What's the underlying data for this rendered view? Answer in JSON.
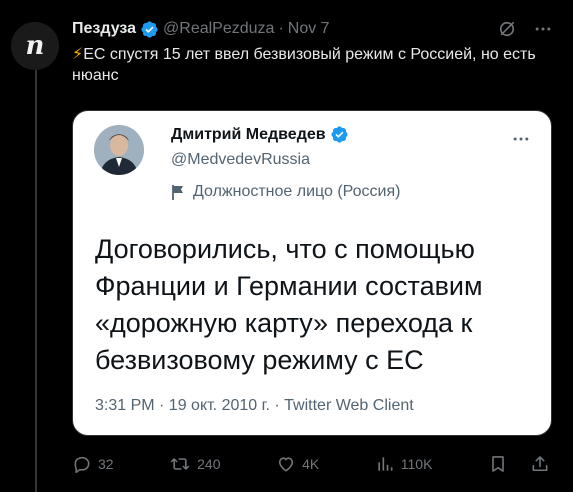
{
  "tweet": {
    "author_name": "Пездуза",
    "author_handle": "@RealPezduza",
    "separator": "·",
    "date": "Nov 7",
    "avatar_letter": "n",
    "emoji": "⚡",
    "text": "ЕС спустя 15 лет ввел безвизовый режим с Россией, но есть нюанс"
  },
  "quoted": {
    "author_name": "Дмитрий Медведев",
    "author_handle": "@MedvedevRussia",
    "label": "Должностное лицо (Россия)",
    "text": "Договорились, что с помощью Франции и Германии составим «дорожную карту» перехода к безвизовому режиму с ЕС",
    "meta": "3:31 PM · 19 окт. 2010 г. · Twitter Web Client"
  },
  "actions": {
    "replies": "32",
    "retweets": "240",
    "likes": "4K",
    "views": "110K"
  },
  "colors": {
    "background": "#000000",
    "verified": "#1d9bf0",
    "text": "#e7e9ea",
    "muted": "#71767b"
  },
  "icons": [
    "verified-badge-icon",
    "grok-icon",
    "more-icon",
    "government-flag-icon",
    "reply-icon",
    "retweet-icon",
    "like-icon",
    "views-icon",
    "bookmark-icon",
    "share-icon"
  ]
}
